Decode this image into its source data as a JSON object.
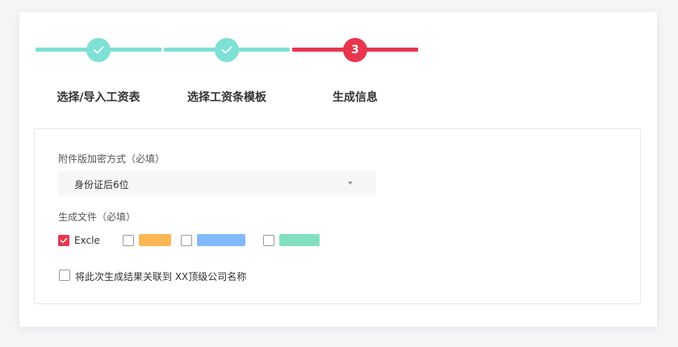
{
  "stepper": {
    "steps": [
      {
        "label": "选择/导入工资表",
        "state": "done",
        "icon": "check-icon"
      },
      {
        "label": "选择工资条模板",
        "state": "done",
        "icon": "check-icon"
      },
      {
        "label": "生成信息",
        "state": "active",
        "number": "3"
      }
    ],
    "colors": {
      "done": "#7fe0d5",
      "active": "#e8364f"
    }
  },
  "form": {
    "encryption_label": "附件版加密方式（必填）",
    "encryption_value": "身份证后6位",
    "files_label": "生成文件（必填）",
    "file_options": [
      {
        "label": "Excle",
        "checked": true
      },
      {
        "color": "#fbb755",
        "checked": false
      },
      {
        "color": "#82b9fa",
        "checked": false
      },
      {
        "color": "#82e0c1",
        "checked": false
      }
    ],
    "link_option": {
      "label": "将此次生成结果关联到 XX顶级公司名称",
      "checked": false
    }
  }
}
